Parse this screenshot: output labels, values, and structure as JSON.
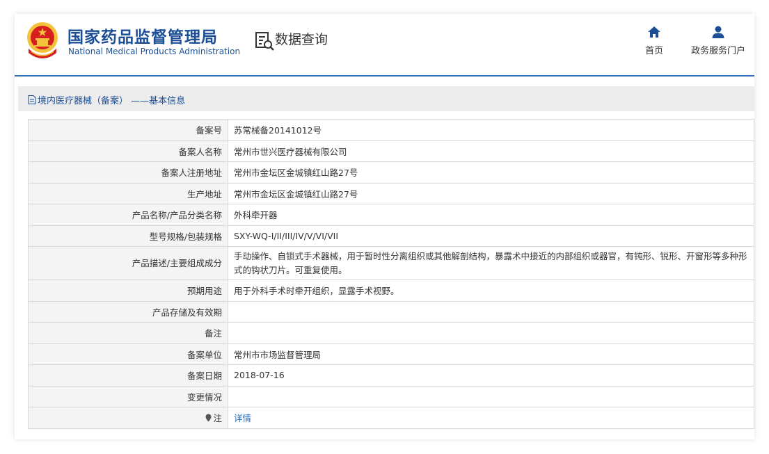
{
  "header": {
    "brand_cn": "国家药品监督管理局",
    "brand_en": "National Medical Products Administration",
    "module_title": "数据查询",
    "nav": [
      {
        "label": "首页",
        "icon": "home-icon"
      },
      {
        "label": "政务服务门户",
        "icon": "user-icon"
      }
    ]
  },
  "breadcrumb": {
    "text": "境内医疗器械（备案） ——基本信息",
    "icon": "document-icon"
  },
  "record": {
    "rows": [
      {
        "label": "备案号",
        "value": "苏常械备20141012号"
      },
      {
        "label": "备案人名称",
        "value": "常州市世兴医疗器械有限公司"
      },
      {
        "label": "备案人注册地址",
        "value": "常州市金坛区金城镇红山路27号"
      },
      {
        "label": "生产地址",
        "value": "常州市金坛区金城镇红山路27号"
      },
      {
        "label": "产品名称/产品分类名称",
        "value": "外科牵开器"
      },
      {
        "label": "型号规格/包装规格",
        "value": "SXY-WQ-I/II/III/IV/V/VI/VII"
      },
      {
        "label": "产品描述/主要组成成分",
        "value": "手动操作、自锁式手术器械，用于暂时性分离组织或其他解剖结构，暴露术中接近的内部组织或器官，有钝形、锐形、开窗形等多种形式的钩状刀片。可重复使用。"
      },
      {
        "label": "预期用途",
        "value": "用于外科手术时牵开组织，显露手术视野。"
      },
      {
        "label": "产品存储及有效期",
        "value": ""
      },
      {
        "label": "备注",
        "value": ""
      },
      {
        "label": "备案单位",
        "value": "常州市市场监督管理局"
      },
      {
        "label": "备案日期",
        "value": "2018-07-16"
      },
      {
        "label": "变更情况",
        "value": ""
      }
    ],
    "note_label": "注",
    "note_link": "详情"
  },
  "colors": {
    "brand": "#1c4f96",
    "accent": "#2a6ab6",
    "label_bg": "#f4f4f4",
    "emblem_red": "#d6201d",
    "emblem_gold": "#f3c33b"
  }
}
